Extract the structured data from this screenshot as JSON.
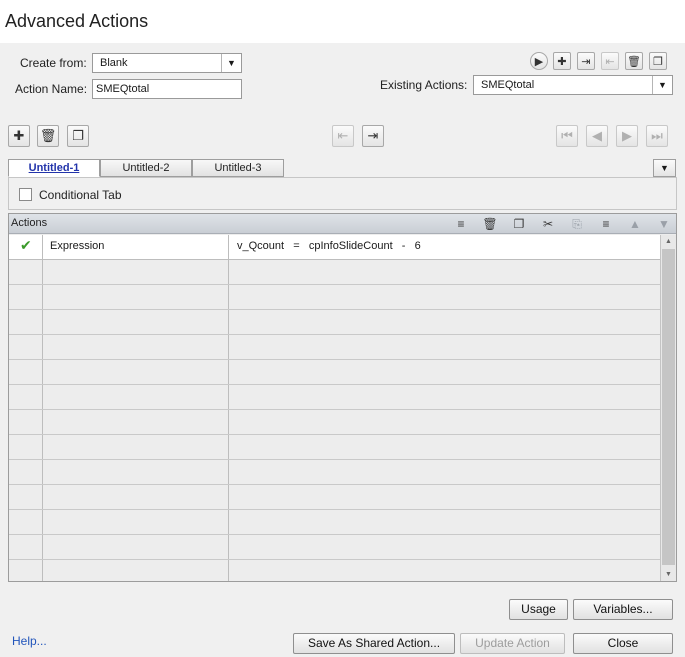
{
  "window": {
    "title": "Advanced Actions"
  },
  "form": {
    "create_from_label": "Create from:",
    "create_from_value": "Blank",
    "action_name_label": "Action Name:",
    "action_name_value": "SMEQtotal",
    "existing_actions_label": "Existing Actions:",
    "existing_actions_value": "SMEQtotal"
  },
  "tabs": [
    {
      "label": "Untitled-1",
      "active": true
    },
    {
      "label": "Untitled-2",
      "active": false
    },
    {
      "label": "Untitled-3",
      "active": false
    }
  ],
  "conditional": {
    "label": "Conditional Tab",
    "checked": false
  },
  "actions": {
    "header_label": "Actions",
    "rows": [
      {
        "status": "valid",
        "type": "Expression",
        "value": "v_Qcount   =   cpInfoSlideCount   -   6"
      }
    ],
    "empty_rows": 13
  },
  "buttons": {
    "usage": "Usage",
    "variables": "Variables...",
    "help": "Help...",
    "save_shared": "Save As Shared Action...",
    "update": "Update Action",
    "close": "Close"
  },
  "icons": {
    "top_right": [
      "preview-icon",
      "add-action-icon",
      "import-icon",
      "export-icon",
      "delete-action-icon",
      "duplicate-action-icon"
    ],
    "tab_toolbar": [
      "add-tab-icon",
      "delete-tab-icon",
      "duplicate-tab-icon",
      "move-tab-left-icon",
      "move-tab-right-icon",
      "first-tab-icon",
      "previous-tab-icon",
      "next-tab-icon",
      "last-tab-icon"
    ],
    "header": [
      "insert-row-icon",
      "delete-row-icon",
      "copy-row-icon",
      "cut-row-icon",
      "paste-row-icon",
      "insert-after-icon",
      "move-up-icon",
      "move-down-icon"
    ]
  },
  "colors": {
    "panel": "#f0f0f0",
    "active_tab_text": "#2233aa",
    "check": "#3a9a2a",
    "link": "#2255bb"
  }
}
